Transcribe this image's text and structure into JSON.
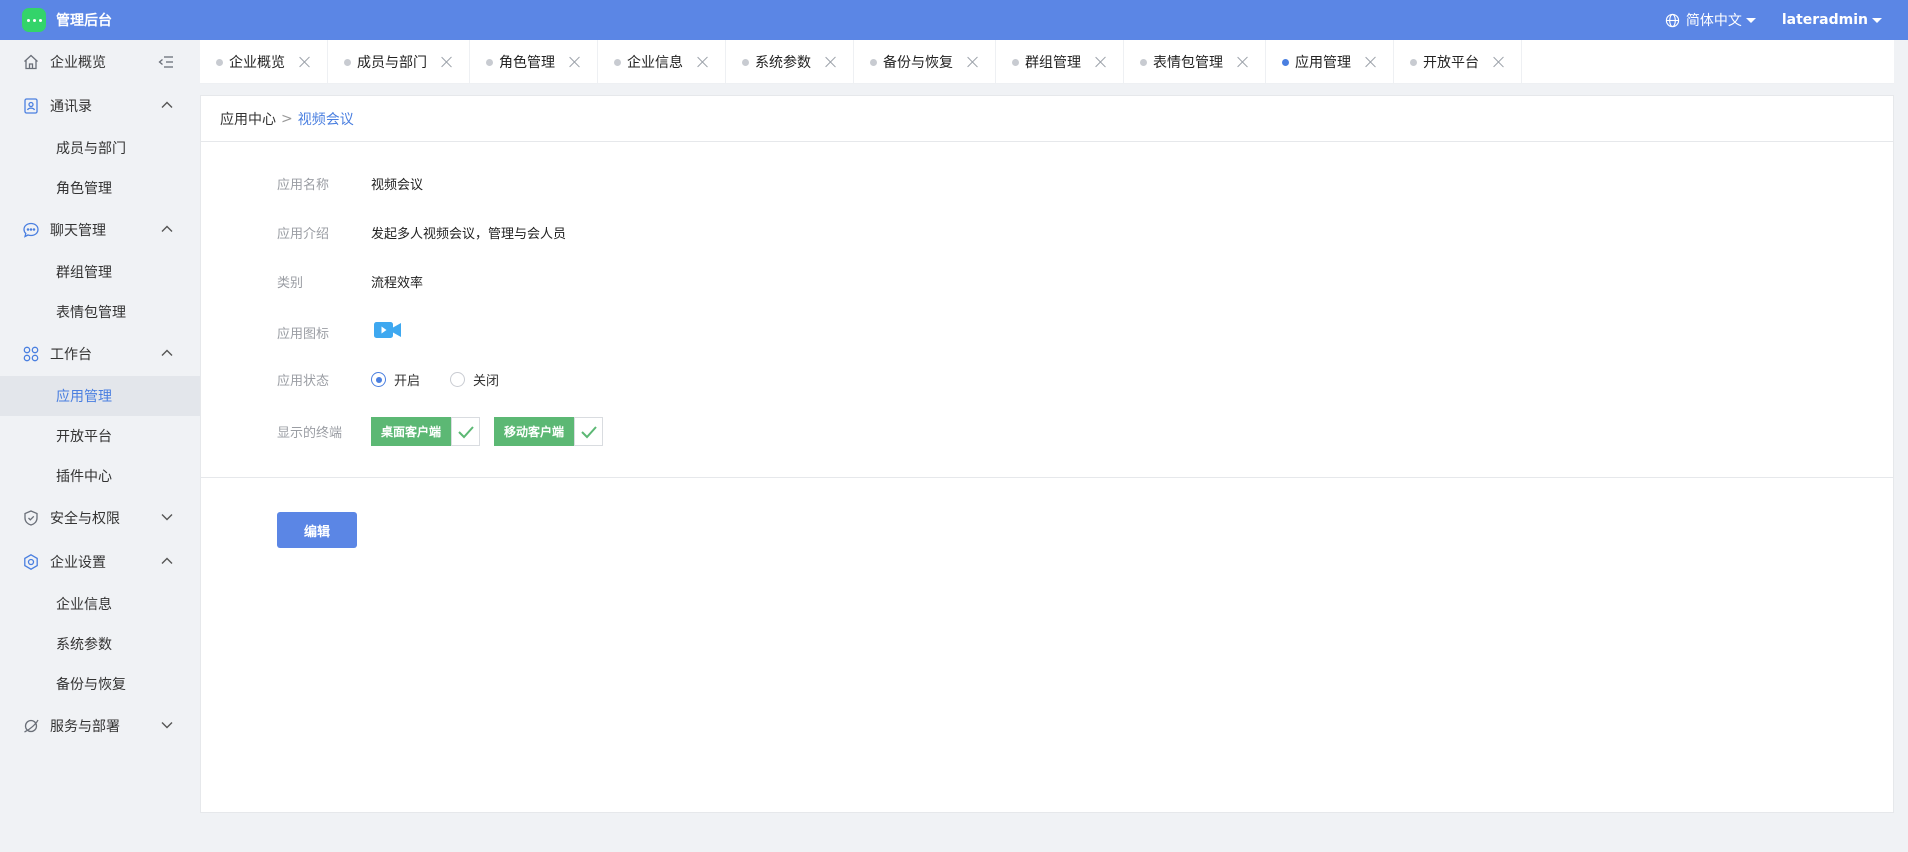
{
  "header": {
    "app_title": "管理后台",
    "language": "简体中文",
    "username": "lateradmin"
  },
  "sidebar": {
    "groups": [
      {
        "label": "企业概览",
        "icon": "home-icon"
      },
      {
        "label": "通讯录",
        "icon": "contacts-icon",
        "items": [
          "成员与部门",
          "角色管理"
        ]
      },
      {
        "label": "聊天管理",
        "icon": "chat-icon",
        "items": [
          "群组管理",
          "表情包管理"
        ]
      },
      {
        "label": "工作台",
        "icon": "grid-icon",
        "items": [
          "应用管理",
          "开放平台",
          "插件中心"
        ]
      },
      {
        "label": "安全与权限",
        "icon": "shield-icon"
      },
      {
        "label": "企业设置",
        "icon": "settings-icon",
        "items": [
          "企业信息",
          "系统参数",
          "备份与恢复"
        ]
      },
      {
        "label": "服务与部署",
        "icon": "deploy-icon"
      }
    ],
    "active_item": "应用管理"
  },
  "tabs": [
    "企业概览",
    "成员与部门",
    "角色管理",
    "企业信息",
    "系统参数",
    "备份与恢复",
    "群组管理",
    "表情包管理",
    "应用管理",
    "开放平台"
  ],
  "active_tab": "应用管理",
  "breadcrumb": {
    "parent": "应用中心",
    "separator": ">",
    "current": "视频会议"
  },
  "form": {
    "name_label": "应用名称",
    "name_value": "视频会议",
    "intro_label": "应用介绍",
    "intro_value": "发起多人视频会议，管理与会人员",
    "category_label": "类别",
    "category_value": "流程效率",
    "icon_label": "应用图标",
    "app_icon": "video-camera-icon",
    "status_label": "应用状态",
    "status_on": "开启",
    "status_off": "关闭",
    "status_selected": "开启",
    "terminal_label": "显示的终端",
    "terminals": [
      "桌面客户端",
      "移动客户端"
    ]
  },
  "actions": {
    "edit": "编辑"
  },
  "colors": {
    "primary": "#5b86e5",
    "active_text": "#4a7fe0",
    "terminal_tag": "#5cb874",
    "logo": "#33d46a"
  }
}
